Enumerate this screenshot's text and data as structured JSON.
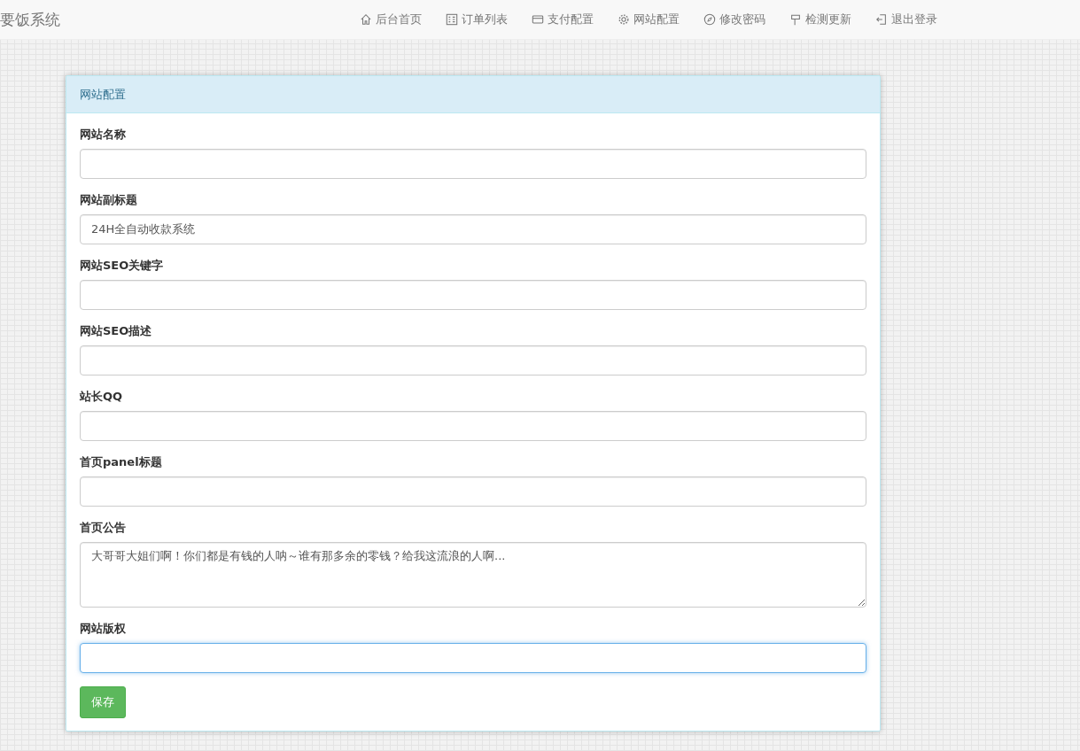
{
  "brand": "要饭系统",
  "nav": [
    {
      "label": "后台首页",
      "kind": "home"
    },
    {
      "label": "订单列表",
      "kind": "list"
    },
    {
      "label": "支付配置",
      "kind": "card"
    },
    {
      "label": "网站配置",
      "kind": "gear"
    },
    {
      "label": "修改密码",
      "kind": "compass"
    },
    {
      "label": "检测更新",
      "kind": "sign"
    },
    {
      "label": "退出登录",
      "kind": "exit"
    }
  ],
  "panel": {
    "title": "网站配置",
    "fields": [
      {
        "label": "网站名称",
        "kind": "input",
        "focused": false
      },
      {
        "label": "网站副标题",
        "kind": "input",
        "value": "24H全自动收款系统",
        "focused": false
      },
      {
        "label": "网站SEO关键字",
        "kind": "input",
        "focused": false
      },
      {
        "label": "网站SEO描述",
        "kind": "input",
        "focused": false
      },
      {
        "label": "站长QQ",
        "kind": "input",
        "focused": false
      },
      {
        "label": "首页panel标题",
        "kind": "input",
        "focused": false
      },
      {
        "label": "首页公告",
        "kind": "textarea",
        "value": "大哥哥大姐们啊！你们都是有钱的人呐～谁有那多余的零钱？给我这流浪的人啊...",
        "focused": false
      },
      {
        "label": "网站版权",
        "kind": "input",
        "focused": true
      }
    ],
    "button": "保存"
  }
}
